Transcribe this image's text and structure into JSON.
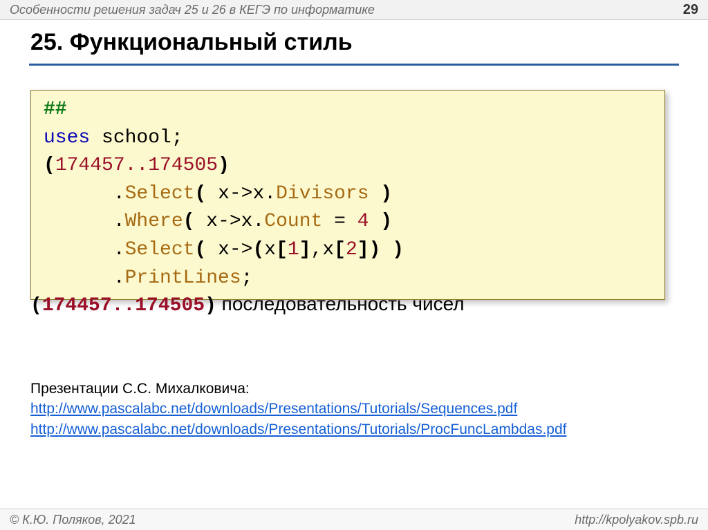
{
  "header": {
    "subject": "Особенности решения задач 25 и 26 в КЕГЭ по информатике",
    "page": "29"
  },
  "title": "25. Функциональный стиль",
  "code": {
    "l1_hash": "##",
    "l2_uses": "uses",
    "l2_school": " school",
    "l2_semi": ";",
    "l3_lp": "(",
    "l3_range": "174457..174505",
    "l3_rp": ")",
    "l4_indent": "      .",
    "l4_select": "Select",
    "l4_open": "( ",
    "l4_x": "x",
    "l4_arrow": "->",
    "l4_xdot": "x",
    "l4_dot": ".",
    "l4_div": "Divisors",
    "l4_close": " )",
    "l5_indent": "      .",
    "l5_where": "Where",
    "l5_open": "( ",
    "l5_x": "x",
    "l5_arrow": "->",
    "l5_xdot": "x",
    "l5_dot": ".",
    "l5_count": "Count",
    "l5_eq": " = ",
    "l5_four": "4",
    "l5_close": " )",
    "l6_indent": "      .",
    "l6_select": "Select",
    "l6_open": "( ",
    "l6_x": "x",
    "l6_arrow": "->",
    "l6_lp": "(",
    "l6_x1a": "x",
    "l6_br1o": "[",
    "l6_one": "1",
    "l6_br1c": "]",
    "l6_comma": ",",
    "l6_x2a": "x",
    "l6_br2o": "[",
    "l6_two": "2",
    "l6_br2c": "]",
    "l6_rp": ")",
    "l6_close": " )",
    "l7_indent": "      .",
    "l7_pl": "PrintLines",
    "l7_semi": ";"
  },
  "explain": {
    "range_lp": "(",
    "range_val": "174457..174505",
    "range_rp": ")",
    "text": "  последовательность чисел"
  },
  "refs": {
    "intro": "Презентации С.С. Михалковича:",
    "link1": "http://www.pascalabc.net/downloads/Presentations/Tutorials/Sequences.pdf",
    "link2": "http://www.pascalabc.net/downloads/Presentations/Tutorials/ProcFuncLambdas.pdf"
  },
  "footer": {
    "copyright": "© К.Ю. Поляков, 2021",
    "url": "http://kpolyakov.spb.ru"
  }
}
